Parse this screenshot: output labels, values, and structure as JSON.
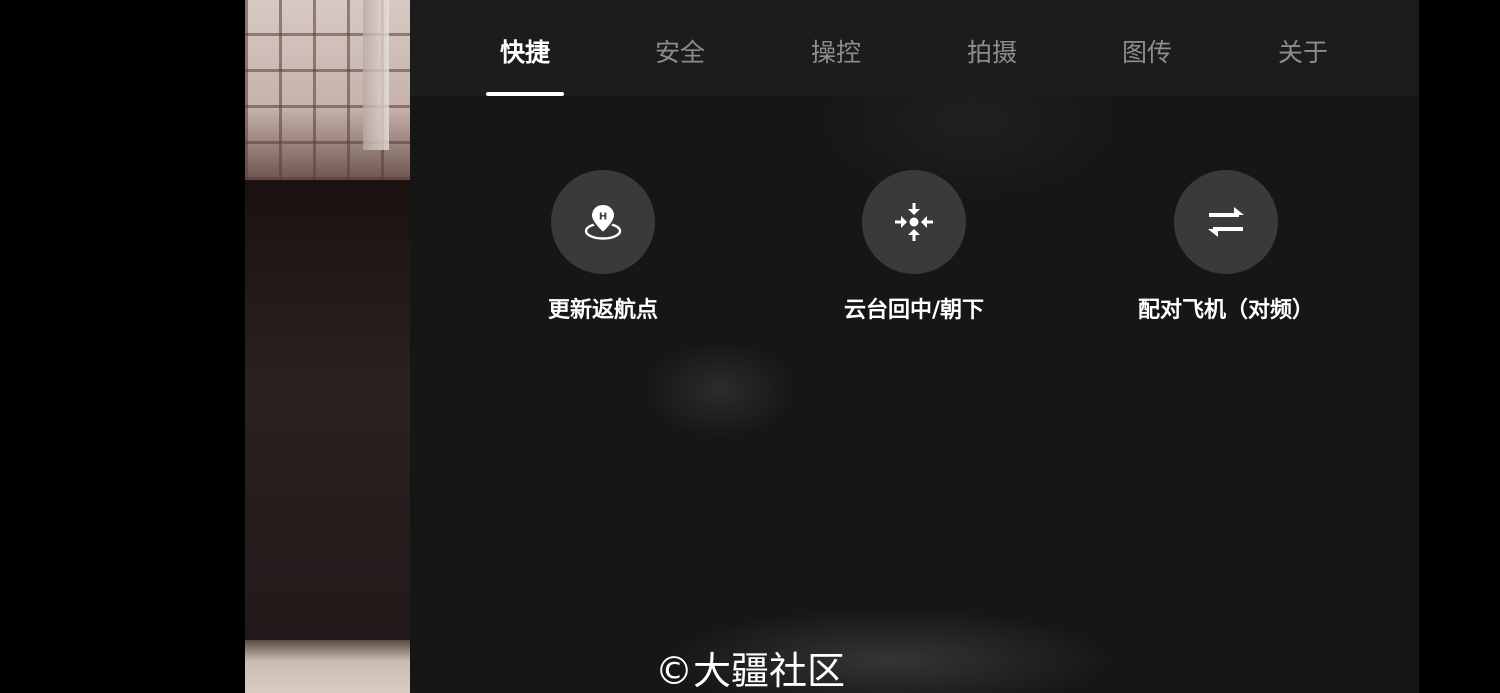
{
  "tabs": [
    {
      "label": "快捷",
      "active": true
    },
    {
      "label": "安全",
      "active": false
    },
    {
      "label": "操控",
      "active": false
    },
    {
      "label": "拍摄",
      "active": false
    },
    {
      "label": "图传",
      "active": false
    },
    {
      "label": "关于",
      "active": false
    }
  ],
  "shortcuts": [
    {
      "label": "更新返航点",
      "icon": "home-point-icon"
    },
    {
      "label": "云台回中/朝下",
      "icon": "gimbal-recenter-icon"
    },
    {
      "label": "配对飞机（对频）",
      "icon": "pair-arrows-icon"
    }
  ],
  "watermark": "©大疆社区",
  "colors": {
    "panel_background": "#161616",
    "tab_bar_background": "#1c1c1c",
    "active_tab": "#ffffff",
    "inactive_tab": "#8d8d8d",
    "icon_circle": "#3a3a3a"
  }
}
